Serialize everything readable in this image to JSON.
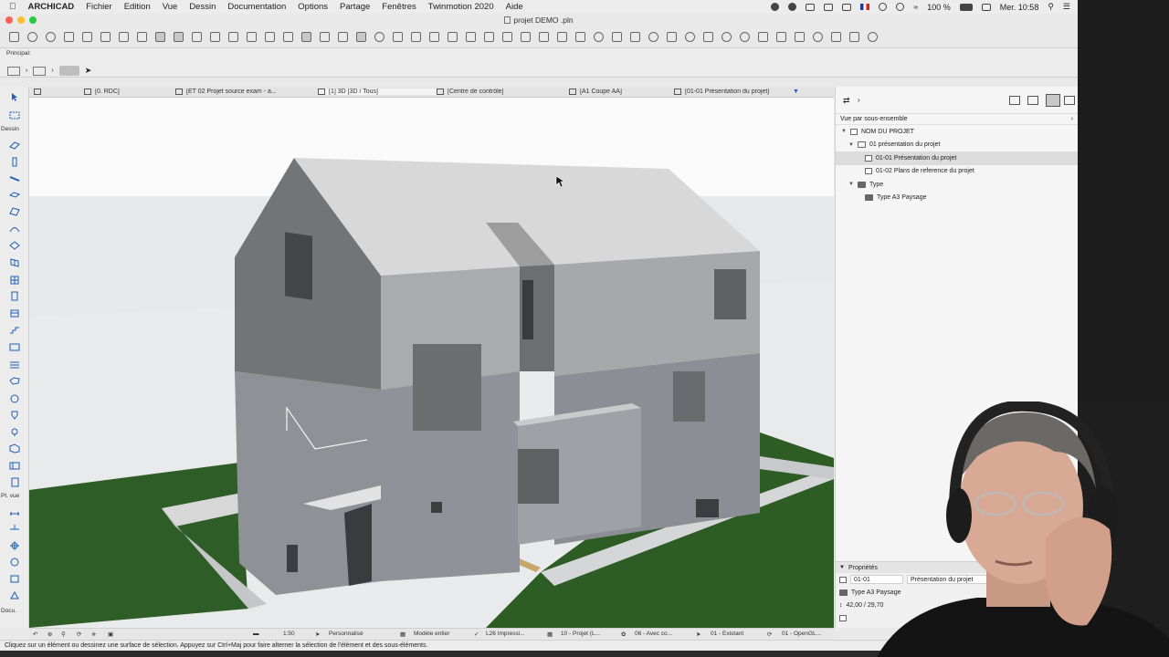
{
  "menubar": {
    "app_name": "ARCHICAD",
    "items": [
      "Fichier",
      "Edition",
      "Vue",
      "Dessin",
      "Documentation",
      "Options",
      "Partage",
      "Fenêtres",
      "Twinmotion 2020",
      "Aide"
    ],
    "battery": "100 %",
    "clock": "Mer. 10:58"
  },
  "window": {
    "title": "projet DEMO .pln"
  },
  "info_box": {
    "label": "Principal:"
  },
  "tabs": [
    {
      "label": "[0. RDC]"
    },
    {
      "label": "[ET 02 Projet source exam - a..."
    },
    {
      "label": "[1] 3D [3D / Tous]"
    },
    {
      "label": "[Centre de contrôle]"
    },
    {
      "label": "[A1 Coupe AA]"
    },
    {
      "label": "[01-01 Présentation du projet]"
    }
  ],
  "toolbox": {
    "sections": [
      "Dessin",
      "Pt. vue",
      "Docu."
    ]
  },
  "navigator": {
    "subset_label": "Vue par sous-ensemble",
    "tree": [
      {
        "label": "NOM DU PROJET"
      },
      {
        "label": "01 présentation du projet"
      },
      {
        "label": "01-01 Présentation du projet"
      },
      {
        "label": "01-02 Plans de reference du projet"
      },
      {
        "label": "Type"
      },
      {
        "label": "Type A3 Paysage"
      }
    ]
  },
  "properties": {
    "title": "Propriétés",
    "id": "01-01",
    "name": "Présentation du projet",
    "format": "Type A3 Paysage",
    "size": "42,00 / 29,70"
  },
  "viewbar": {
    "scale": "1:50",
    "layer_combo": "Personnalisé",
    "model": "Modèle entier",
    "pen_set": "L26 Impressi...",
    "model_view": "10 - Projet (L...",
    "overrides": "06 - Avec co...",
    "renovation": "01 - Existant",
    "engine": "01 - OpenGL..."
  },
  "status": {
    "message": "Cliquez sur un élément ou dessinez une surface de sélection. Appuyez sur Ctrl+Maj pour faire alterner la sélection de l'élément et des sous-éléments."
  },
  "colors": {
    "sky": "#e8ebee",
    "ground": "#eeeeee",
    "grass": "#2e5c25",
    "roof": "#d9d9d9",
    "wall": "#9a9da3",
    "selection": "#dcdcdc"
  }
}
